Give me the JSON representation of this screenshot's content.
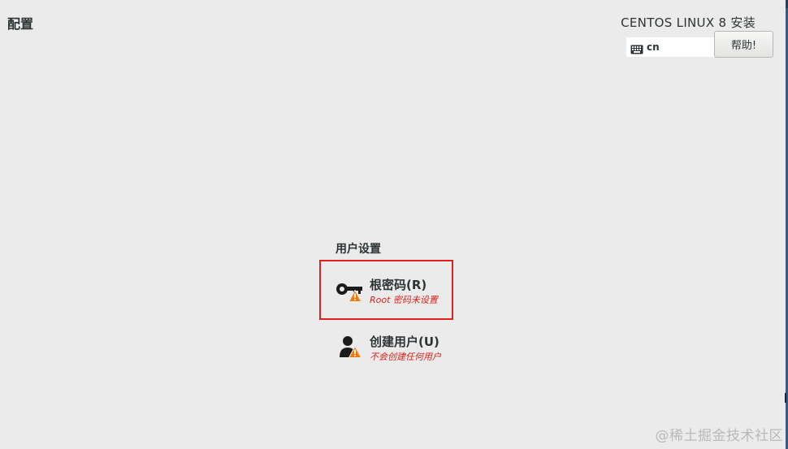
{
  "header": {
    "page_title": "配置",
    "product_title": "CENTOS LINUX 8 安装",
    "keyboard_layout": "cn",
    "help_label": "帮助!"
  },
  "user_settings": {
    "title": "用户设置",
    "spokes": [
      {
        "label": "根密码(R)",
        "status": "Root 密码未设置",
        "icon": "key-icon",
        "warning": true,
        "highlighted": true
      },
      {
        "label": "创建用户(U)",
        "status": "不会创建任何用户",
        "icon": "user-icon",
        "warning": true,
        "highlighted": false
      }
    ]
  },
  "watermark": "@稀土掘金技术社区",
  "colors": {
    "background": "#ebebeb",
    "warning_text": "#d8231c",
    "highlight_border": "#e0201b",
    "warning_icon": "#f57900",
    "accent_edge": "#2c5a9a"
  }
}
